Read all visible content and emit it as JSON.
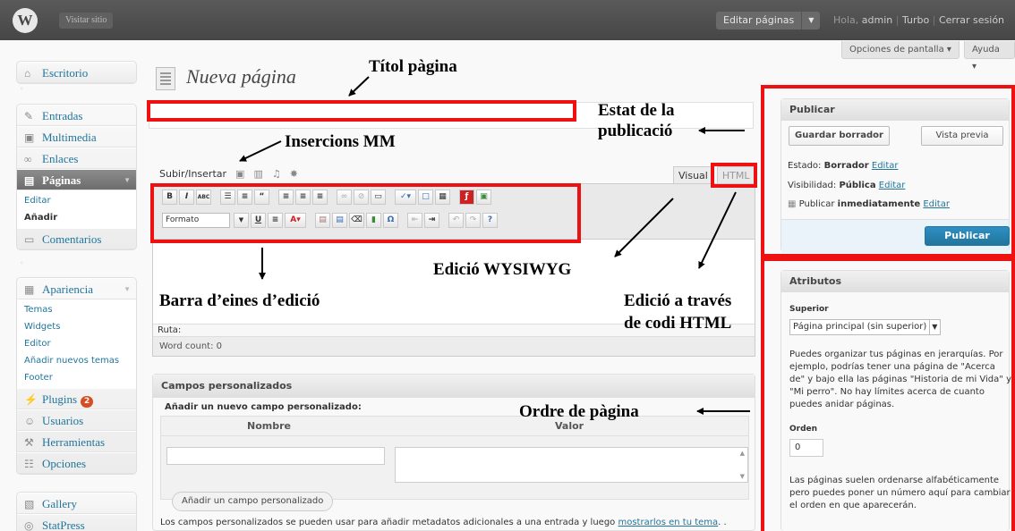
{
  "header": {
    "logo_glyph": "W",
    "visit_site": "Visitar sitio",
    "edit_pages": "Editar páginas",
    "edit_pages_arrow": "▼",
    "greeting": "Hola,",
    "user": "admin",
    "sep1": "|",
    "turbo": "Turbo",
    "sep2": "|",
    "logout": "Cerrar sesión"
  },
  "screen_options": "Opciones de pantalla",
  "help": "Ayuda",
  "sidebar": {
    "dashboard": "Escritorio",
    "posts": "Entradas",
    "media": "Multimedia",
    "links": "Enlaces",
    "pages": "Páginas",
    "pages_sub": [
      "Editar",
      "Añadir"
    ],
    "comments": "Comentarios",
    "appearance": "Apariencia",
    "appearance_sub": [
      "Temas",
      "Widgets",
      "Editor",
      "Añadir nuevos temas",
      "Footer"
    ],
    "plugins": "Plugins",
    "plugins_count": "2",
    "users": "Usuarios",
    "tools": "Herramientas",
    "settings": "Opciones",
    "gallery": "Gallery",
    "statpress": "StatPress"
  },
  "main": {
    "title": "Nueva página",
    "upload_insert": "Subir/Insertar",
    "tab_visual": "Visual",
    "tab_html": "HTML",
    "format_select": "Formato",
    "path_label": "Ruta:",
    "word_count": "Word count: 0"
  },
  "custom_fields": {
    "heading": "Campos personalizados",
    "add_new": "Añadir un nuevo campo personalizado:",
    "col_name": "Nombre",
    "col_value": "Valor",
    "add_button": "Añadir un campo personalizado",
    "note": "Los campos personalizados se pueden usar para añadir metadatos adicionales a una entrada y luego",
    "note_link": "mostrarlos en tu tema",
    "note_end": ". ."
  },
  "publish": {
    "heading": "Publicar",
    "save_draft": "Guardar borrador",
    "preview": "Vista previa",
    "status_label": "Estado:",
    "status_value": "Borrador",
    "visibility_label": "Visibilidad:",
    "visibility_value": "Pública",
    "publish_label": "Publicar",
    "publish_when": "inmediatamente",
    "edit": "Editar",
    "publish_button": "Publicar"
  },
  "attributes": {
    "heading": "Atributos",
    "parent_label": "Superior",
    "parent_value": "Página principal (sin superior)",
    "parent_help": "Puedes organizar tus páginas en jerarquías. Por ejemplo, podrías tener una página de \"Acerca de\" y bajo ella las páginas \"Historia de mi Vida\" y \"Mi perro\". No hay límites acerca de cuanto puedes anidar páginas.",
    "order_label": "Orden",
    "order_value": "0",
    "order_help": "Las páginas suelen ordenarse alfabéticamente pero puedes poner un número aquí para cambiar el orden en que aparecerán."
  },
  "annotations": {
    "title": "Títol pàgina",
    "status_line1": "Estat de la",
    "status_line2": "publicació",
    "media": "Insercions MM",
    "wysiwyg": "Edició WYSIWYG",
    "toolbar": "Barra d’eines d’edició",
    "html_line1": "Edició a través",
    "html_line2": "de codi HTML",
    "order": "Ordre de pàgina",
    "color": "#ee1111"
  }
}
